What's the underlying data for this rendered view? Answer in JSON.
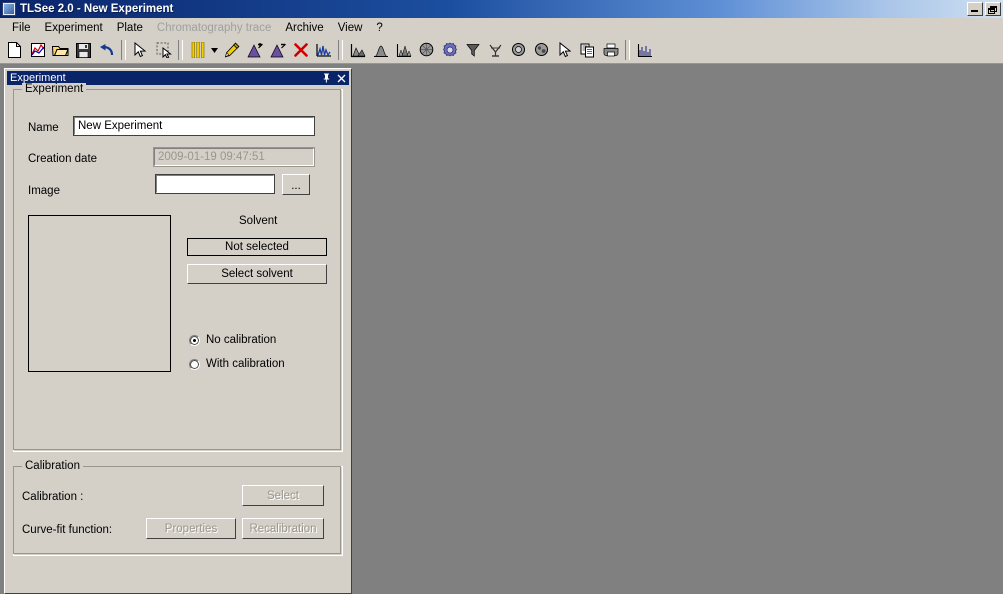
{
  "window": {
    "title": "TLSee 2.0 - New Experiment",
    "icon": "app-icon",
    "controls": [
      {
        "name": "minimize-button",
        "glyph": "minimize"
      },
      {
        "name": "restore-button",
        "glyph": "restore"
      }
    ]
  },
  "menu": {
    "items": [
      {
        "label": "File",
        "disabled": false
      },
      {
        "label": "Experiment",
        "disabled": false
      },
      {
        "label": "Plate",
        "disabled": false
      },
      {
        "label": "Chromatography trace",
        "disabled": true
      },
      {
        "label": "Archive",
        "disabled": false
      },
      {
        "label": "View",
        "disabled": false
      },
      {
        "label": "?",
        "disabled": false
      }
    ]
  },
  "toolbar": {
    "items": [
      {
        "name": "new-document-icon",
        "type": "button"
      },
      {
        "name": "new-experiment-chart-icon",
        "type": "button"
      },
      {
        "name": "open-folder-icon",
        "type": "button"
      },
      {
        "name": "save-disk-icon",
        "type": "button"
      },
      {
        "name": "undo-icon",
        "type": "button"
      },
      {
        "name": "separator-1",
        "type": "separator"
      },
      {
        "name": "pointer-arrow-icon",
        "type": "button"
      },
      {
        "name": "marquee-select-icon",
        "type": "button"
      },
      {
        "name": "separator-2",
        "type": "separator"
      },
      {
        "name": "lanes-icon",
        "type": "button"
      },
      {
        "name": "lanes-dropdown-arrow-icon",
        "type": "dropdown"
      },
      {
        "name": "pencil-edit-icon",
        "type": "button"
      },
      {
        "name": "peak-add-icon",
        "type": "button"
      },
      {
        "name": "peak-remove-icon",
        "type": "button"
      },
      {
        "name": "delete-cross-icon",
        "type": "button"
      },
      {
        "name": "chromatogram-icon",
        "type": "button"
      },
      {
        "name": "separator-3",
        "type": "separator"
      },
      {
        "name": "baseline-left-icon",
        "type": "button"
      },
      {
        "name": "peak-single-icon",
        "type": "button"
      },
      {
        "name": "peak-multi-icon",
        "type": "button"
      },
      {
        "name": "spot-detect-icon",
        "type": "button"
      },
      {
        "name": "gear-settings-icon",
        "type": "button"
      },
      {
        "name": "filter-funnel-icon",
        "type": "button"
      },
      {
        "name": "integrate-icon",
        "type": "button"
      },
      {
        "name": "zoom-spot-icon",
        "type": "button"
      },
      {
        "name": "spot-measure-icon",
        "type": "button"
      },
      {
        "name": "picker-arrow-icon",
        "type": "button"
      },
      {
        "name": "copy-icon",
        "type": "button"
      },
      {
        "name": "print-icon",
        "type": "button"
      },
      {
        "name": "separator-4",
        "type": "separator"
      },
      {
        "name": "histogram-icon",
        "type": "button"
      }
    ]
  },
  "panel": {
    "title": "Experiment",
    "pin_label": "Auto hide",
    "close_label": "Close"
  },
  "experiment_group": {
    "legend": "Experiment",
    "name_label": "Name",
    "name_value": "New Experiment",
    "name_placeholder": "",
    "creation_date_label": "Creation date",
    "creation_date_value": "2009-01-19 09:47:51",
    "image_label": "Image",
    "image_value": "",
    "image_placeholder": "",
    "image_browse_label": "...",
    "solvent_label": "Solvent",
    "solvent_status": "Not selected",
    "select_solvent_label": "Select solvent",
    "calibration_options": [
      {
        "label": "No calibration",
        "checked": true
      },
      {
        "label": "With calibration",
        "checked": false
      }
    ]
  },
  "calibration_group": {
    "legend": "Calibration",
    "calibration_label": "Calibration :",
    "select_label": "Select",
    "curve_fit_label": "Curve-fit function:",
    "properties_label": "Properties",
    "recalibration_label": "Recalibration"
  },
  "colors": {
    "titlebar_start": "#0a246a",
    "titlebar_end": "#cfe0f2",
    "face": "#d4d0c8",
    "mdi_background": "#808080",
    "panel_title": "#0a246a",
    "disabled_text": "#9a968e"
  }
}
